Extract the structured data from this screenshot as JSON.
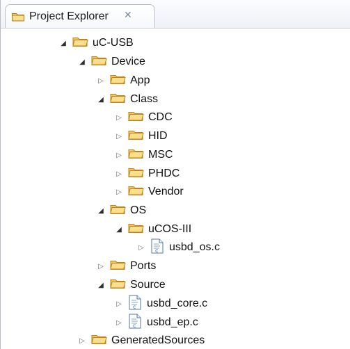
{
  "tab": {
    "title": "Project Explorer",
    "close_icon": "close-icon",
    "folder_icon": "folder-icon"
  },
  "tree": {
    "nodes": [
      {
        "label": "uC-USB",
        "type": "folder",
        "expanded": true
      },
      {
        "label": "Device",
        "type": "folder",
        "expanded": true
      },
      {
        "label": "App",
        "type": "folder",
        "expanded": false
      },
      {
        "label": "Class",
        "type": "folder",
        "expanded": true
      },
      {
        "label": "CDC",
        "type": "folder",
        "expanded": false
      },
      {
        "label": "HID",
        "type": "folder",
        "expanded": false
      },
      {
        "label": "MSC",
        "type": "folder",
        "expanded": false
      },
      {
        "label": "PHDC",
        "type": "folder",
        "expanded": false
      },
      {
        "label": "Vendor",
        "type": "folder",
        "expanded": false
      },
      {
        "label": "OS",
        "type": "folder",
        "expanded": true
      },
      {
        "label": "uCOS-III",
        "type": "folder",
        "expanded": true
      },
      {
        "label": "usbd_os.c",
        "type": "c-file",
        "expanded": false
      },
      {
        "label": "Ports",
        "type": "folder",
        "expanded": false
      },
      {
        "label": "Source",
        "type": "folder",
        "expanded": true
      },
      {
        "label": "usbd_core.c",
        "type": "c-file",
        "expanded": false
      },
      {
        "label": "usbd_ep.c",
        "type": "c-file",
        "expanded": false
      },
      {
        "label": "GeneratedSources",
        "type": "folder",
        "expanded": false
      }
    ]
  },
  "colors": {
    "folder_fill": "#f7d98a",
    "folder_stroke": "#c78b13",
    "c_file_accent": "#2f68b5"
  }
}
